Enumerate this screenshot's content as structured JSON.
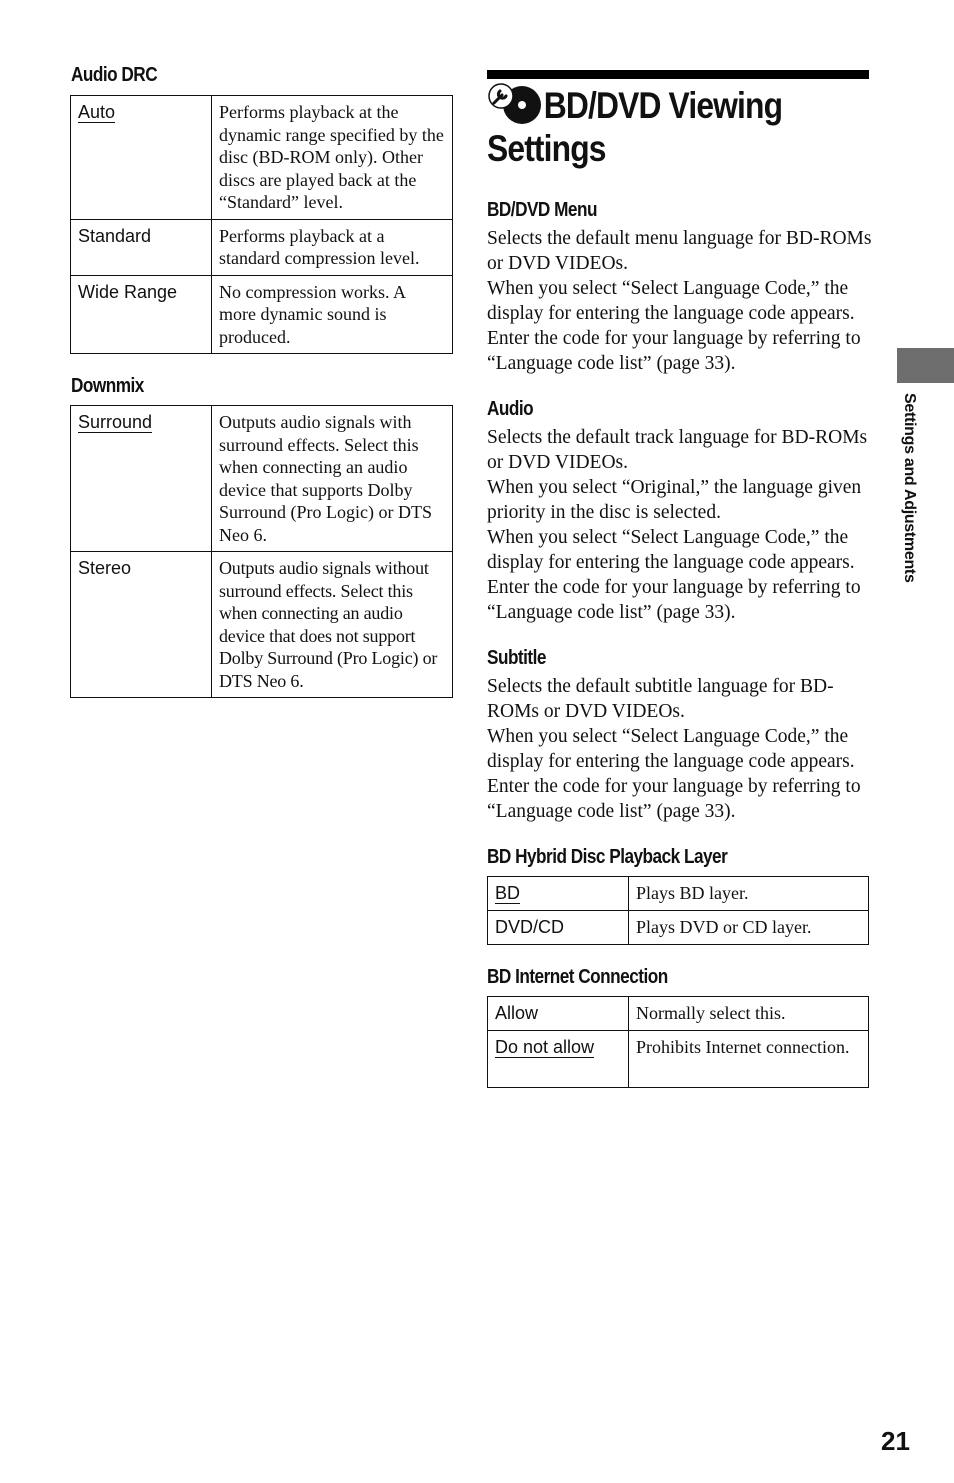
{
  "page_number": "21",
  "side_tab_label": "Settings and Adjustments",
  "left_column": {
    "audio_drc": {
      "heading": "Audio DRC",
      "rows": [
        {
          "option": "Auto",
          "default": true,
          "description": "Performs playback at the dynamic range specified by the disc (BD-ROM only). Other discs are played back at the “Standard” level."
        },
        {
          "option": "Standard",
          "default": false,
          "description": "Performs playback at a standard compression level."
        },
        {
          "option": "Wide Range",
          "default": false,
          "description": "No compression works. A more dynamic sound is produced."
        }
      ]
    },
    "downmix": {
      "heading": "Downmix",
      "rows": [
        {
          "option": "Surround",
          "default": true,
          "description": "Outputs audio signals with surround effects. Select this when connecting an audio device that supports Dolby Surround (Pro Logic) or DTS Neo 6."
        },
        {
          "option": "Stereo",
          "default": false,
          "description": "Outputs audio signals without surround effects. Select this when connecting an audio device that does not support Dolby Surround (Pro Logic) or DTS Neo 6."
        }
      ]
    }
  },
  "right_column": {
    "section_title_line1": "BD/DVD Viewing",
    "section_title_line2": "Settings",
    "section_icon": "wrench-disc-icon",
    "bd_dvd_menu": {
      "heading": "BD/DVD Menu",
      "paragraphs": [
        "Selects the default menu language for BD-ROMs or DVD VIDEOs.",
        "When you select “Select Language Code,” the display for entering the language code appears. Enter the code for your language by referring to “Language code list” (page 33)."
      ]
    },
    "audio": {
      "heading": "Audio",
      "paragraphs": [
        "Selects the default track language for BD-ROMs or DVD VIDEOs.",
        "When you select “Original,” the language given priority in the disc is selected.",
        "When you select “Select Language Code,” the display for entering the language code appears. Enter the code for your language by referring to “Language code list” (page 33)."
      ]
    },
    "subtitle": {
      "heading": "Subtitle",
      "paragraphs": [
        "Selects the default subtitle language for BD-ROMs or DVD VIDEOs.",
        "When you select “Select Language Code,” the display for entering the language code appears. Enter the code for your language by referring to “Language code list” (page 33)."
      ]
    },
    "bd_hybrid": {
      "heading": "BD Hybrid Disc Playback Layer",
      "rows": [
        {
          "option": "BD",
          "default": true,
          "description": "Plays BD layer."
        },
        {
          "option": "DVD/CD",
          "default": false,
          "description": "Plays DVD or CD layer."
        }
      ]
    },
    "bd_internet": {
      "heading": "BD Internet Connection",
      "rows": [
        {
          "option": "Allow",
          "default": false,
          "description": "Normally select this."
        },
        {
          "option": "Do not allow",
          "default": true,
          "description": "Prohibits Internet connection."
        }
      ]
    }
  }
}
